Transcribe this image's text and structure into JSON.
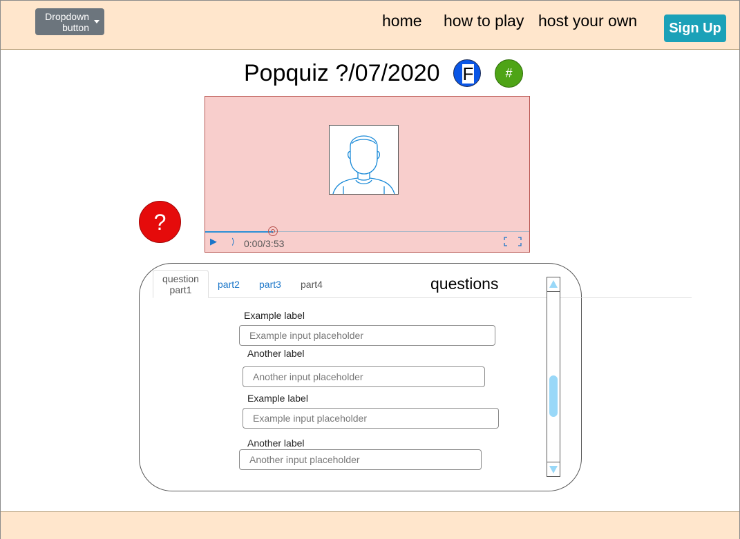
{
  "navbar": {
    "dropdown_label": "Dropdown button",
    "links": [
      "home",
      "how to play",
      "host your own"
    ],
    "signup_label": "Sign Up"
  },
  "header": {
    "title": "Popquiz ?/07/2020",
    "facebook_letter": "F",
    "hash_symbol": "#"
  },
  "help": {
    "symbol": "?"
  },
  "video": {
    "time": "0:00/3:53",
    "progress_fraction": 0.21,
    "icons": [
      "play-icon",
      "volume-icon",
      "fullscreen-icon"
    ]
  },
  "quiz": {
    "tabs": [
      "question part1",
      "part2",
      "part3",
      "part4"
    ],
    "title": "questions",
    "fields": [
      {
        "label": "Example label",
        "placeholder": "Example input placeholder"
      },
      {
        "label": "Another label",
        "placeholder": "Another input placeholder"
      },
      {
        "label": "Example label",
        "placeholder": "Example input placeholder"
      },
      {
        "label": "Another label",
        "placeholder": "Another input placeholder"
      }
    ],
    "scroll_position_fraction": 0.65
  },
  "colors": {
    "navbar_bg": "#ffe6cc",
    "signup": "#1ba1b8",
    "facebook": "#0a56e6",
    "hash": "#4ea416",
    "help": "#e50b0b",
    "video_bg": "#f8cecc",
    "scroll_thumb": "#99d8f8"
  }
}
